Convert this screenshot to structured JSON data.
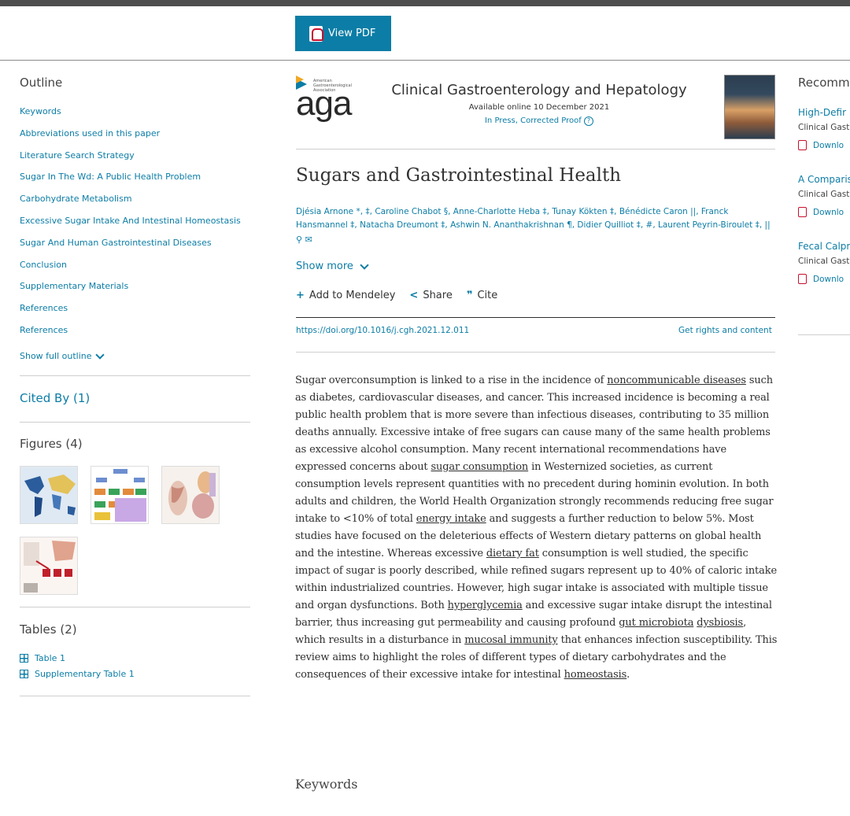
{
  "toolbar": {
    "view_pdf": "View PDF"
  },
  "outline": {
    "title": "Outline",
    "items": [
      "Keywords",
      "Abbreviations used in this paper",
      "Literature Search Strategy",
      "Sugar In The Wd: A Public Health Problem",
      "Carbohydrate Metabolism",
      "Excessive Sugar Intake And Intestinal Homeostasis",
      "Sugar And Human Gastrointestinal Diseases",
      "Conclusion",
      "Supplementary Materials",
      "References",
      "References"
    ],
    "show_full": "Show full outline"
  },
  "cited_by": "Cited By (1)",
  "figures": {
    "title": "Figures (4)"
  },
  "tables": {
    "title": "Tables (2)",
    "items": [
      "Table 1",
      "Supplementary Table 1"
    ]
  },
  "journal": {
    "logo_small": "American Gastroenterological Association",
    "logo_big": "aga",
    "name": "Clinical Gastroenterology and Hepatology",
    "available": "Available online 10 December 2021",
    "status": "In Press, Corrected Proof"
  },
  "article": {
    "title": "Sugars and Gastrointestinal Health",
    "authors": "Djésia Arnone *, ‡, Caroline Chabot §, Anne-Charlotte Heba ‡, Tunay Kökten ‡, Bénédicte Caron ||, Franck Hansmannel ‡, Natacha Dreumont ‡, Ashwin N. Ananthakrishnan ¶, Didier Quilliot ‡, #, Laurent Peyrin-Biroulet ‡, ||",
    "show_more": "Show more",
    "add_mendeley": "Add to Mendeley",
    "share": "Share",
    "cite": "Cite",
    "doi": "https://doi.org/10.1016/j.cgh.2021.12.011",
    "rights": "Get rights and content",
    "keywords_heading": "Keywords"
  },
  "recommended": {
    "title": "Recomm",
    "items": [
      {
        "title": "High-Defir",
        "journal": "Clinical Gast",
        "download": "Downlo"
      },
      {
        "title": "A Comparis",
        "journal": "Clinical Gast",
        "download": "Downlo"
      },
      {
        "title": "Fecal Calpr",
        "journal": "Clinical Gast",
        "download": "Downlo"
      }
    ]
  },
  "colors": {
    "accent": "#0c7da6",
    "pdf_red": "#c8102e"
  }
}
